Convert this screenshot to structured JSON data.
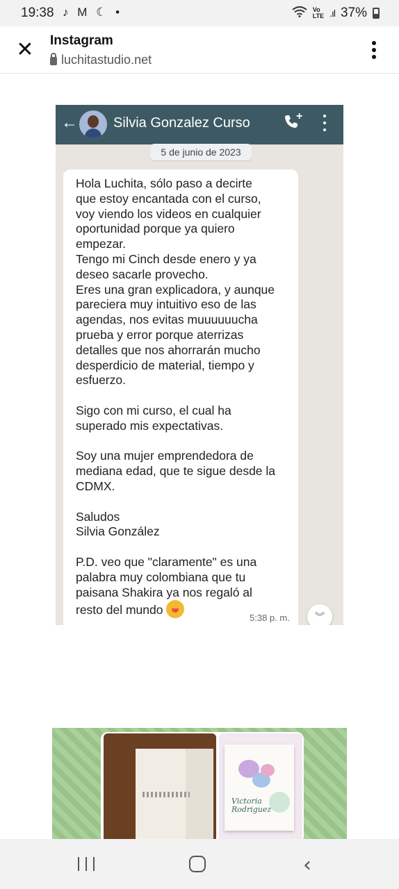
{
  "status_bar": {
    "time": "19:38",
    "notification_icons": "♪ M ☾ •",
    "volte": "Vo\nLTE",
    "signal": ".ıl",
    "battery": "37%"
  },
  "browser": {
    "title": "Instagram",
    "url": "luchitastudio.net"
  },
  "chat": {
    "contact_name": "Silvia Gonzalez Curso",
    "date_badge": "5 de junio de 2023",
    "message": "Hola Luchita, sólo paso a decirte\nque estoy encantada con el curso,\nvoy viendo los videos en cualquier\noportunidad porque ya quiero\nempezar.\nTengo mi Cinch desde enero y ya\ndeseo sacarle provecho.\nEres una gran explicadora, y aunque\npareciera muy intuitivo eso de las\nagendas, nos evitas muuuuuucha\nprueba y error porque aterrizas\ndetalles que nos ahorrarán mucho\ndesperdicio de material, tiempo y\nesfuerzo.\n\nSigo con mi curso, el cual ha\nsuperado mis expectativas.\n\nSoy una mujer emprendedora de\nmediana edad, que te sigue desde la\nCDMX.\n\nSaludos\nSilvia González\n\nP.D. veo que \"claramente\" es una\npalabra muy colombiana que tu\npaisana Shakira ya nos regaló al\nresto del mundo ",
    "emoji_icon": "smiling-face-with-hand-over-mouth",
    "timestamp": "5:38 p. m."
  },
  "photo": {
    "planner_name": "Victoria\nRodriguez"
  },
  "colors": {
    "wa_header": "#3d5a64",
    "wa_background": "#e8e4df",
    "strip_green": "#9ec98d"
  }
}
